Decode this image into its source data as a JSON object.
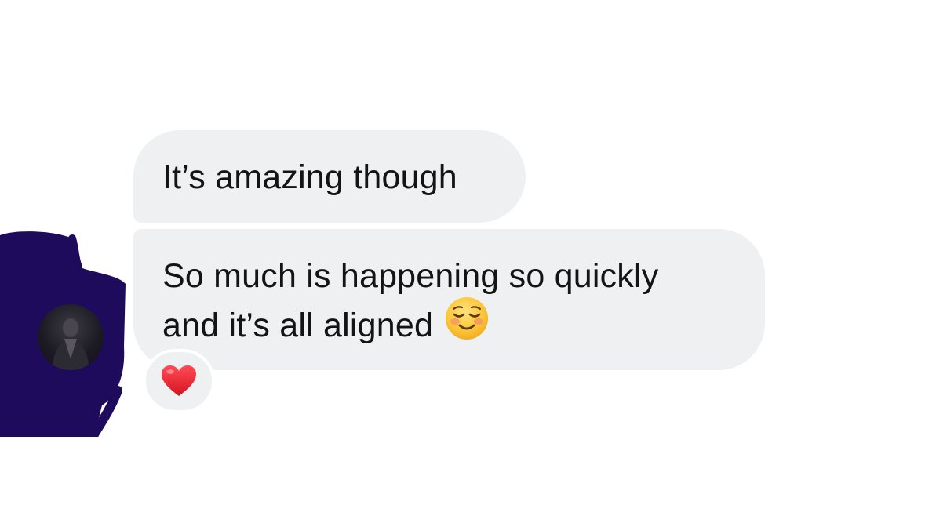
{
  "conversation": {
    "messages": [
      {
        "lines": [
          "It’s amazing though"
        ]
      },
      {
        "lines": [
          "So much is happening so quickly",
          "and it’s all aligned"
        ],
        "trailing_emoji": "smiling-face-icon",
        "reaction": "heart-icon"
      }
    ]
  },
  "colors": {
    "bubble_bg": "#eff0f2",
    "text": "#141414",
    "redaction": "#1e0b5c",
    "heart": "#e6232e",
    "emoji_face": "#fbc02d"
  }
}
